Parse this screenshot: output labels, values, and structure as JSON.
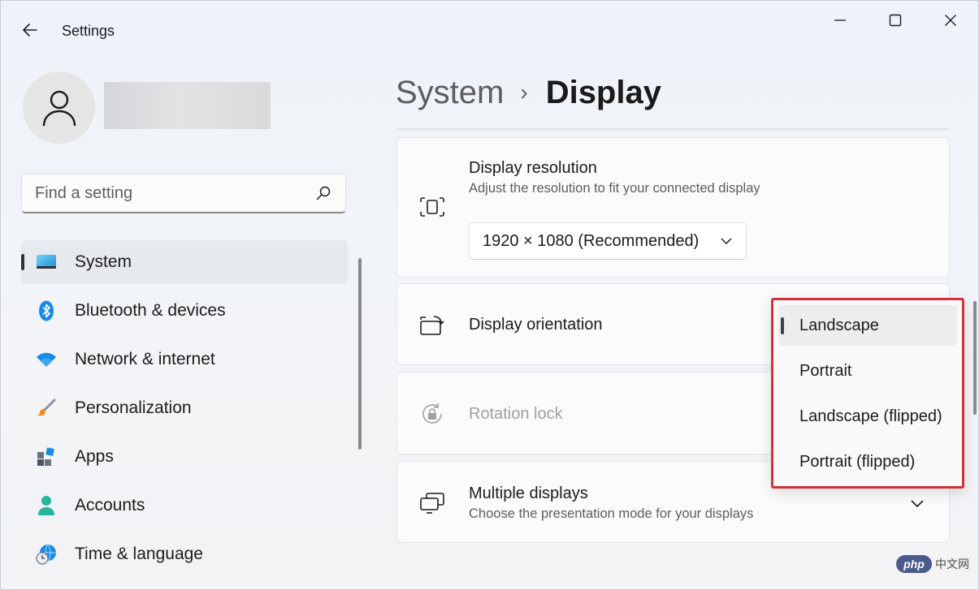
{
  "window": {
    "app_title": "Settings"
  },
  "search": {
    "placeholder": "Find a setting"
  },
  "sidebar": {
    "items": [
      {
        "label": "System",
        "icon": "monitor-icon",
        "active": true
      },
      {
        "label": "Bluetooth & devices",
        "icon": "bluetooth-icon"
      },
      {
        "label": "Network & internet",
        "icon": "wifi-icon"
      },
      {
        "label": "Personalization",
        "icon": "paintbrush-icon"
      },
      {
        "label": "Apps",
        "icon": "apps-icon"
      },
      {
        "label": "Accounts",
        "icon": "person-icon"
      },
      {
        "label": "Time & language",
        "icon": "globe-clock-icon"
      }
    ]
  },
  "breadcrumb": {
    "parent": "System",
    "separator": "›",
    "current": "Display"
  },
  "cards": {
    "resolution": {
      "title": "Display resolution",
      "subtitle": "Adjust the resolution to fit your connected display",
      "selected_value": "1920 × 1080 (Recommended)"
    },
    "orientation": {
      "title": "Display orientation"
    },
    "rotation_lock": {
      "title": "Rotation lock"
    },
    "multiple_displays": {
      "title": "Multiple displays",
      "subtitle": "Choose the presentation mode for your displays"
    }
  },
  "orientation_flyout": {
    "options": [
      "Landscape",
      "Portrait",
      "Landscape (flipped)",
      "Portrait (flipped)"
    ],
    "selected_index": 0,
    "highlight_color": "#d1313b"
  },
  "watermark": {
    "logo_text": "php",
    "site_text": "中文网"
  },
  "colors": {
    "accent": "#0067c0",
    "selection_indicator": "#3b4256"
  }
}
